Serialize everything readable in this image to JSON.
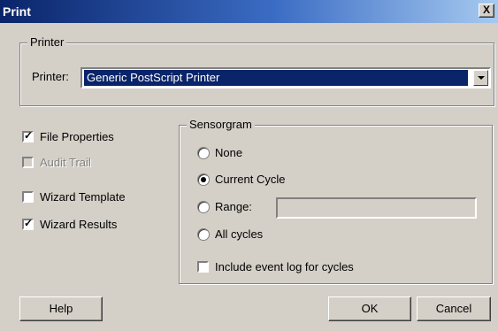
{
  "window": {
    "title": "Print",
    "close_label": "X"
  },
  "printer_group": {
    "legend": "Printer",
    "label": "Printer:",
    "selected_printer": "Generic PostScript Printer"
  },
  "options": [
    {
      "label": "File Properties",
      "checked": true,
      "enabled": true
    },
    {
      "label": "Audit Trail",
      "checked": false,
      "enabled": false
    },
    {
      "label": "Wizard Template",
      "checked": false,
      "enabled": true
    },
    {
      "label": "Wizard Results",
      "checked": true,
      "enabled": true
    }
  ],
  "sensorgram": {
    "legend": "Sensorgram",
    "radios": [
      {
        "label": "None",
        "selected": false
      },
      {
        "label": "Current Cycle",
        "selected": true
      },
      {
        "label": "Range:",
        "selected": false
      },
      {
        "label": "All cycles",
        "selected": false
      }
    ],
    "range_value": "",
    "include_event_log": {
      "label": "Include event log for cycles",
      "checked": false
    }
  },
  "buttons": {
    "help": "Help",
    "ok": "OK",
    "cancel": "Cancel"
  }
}
